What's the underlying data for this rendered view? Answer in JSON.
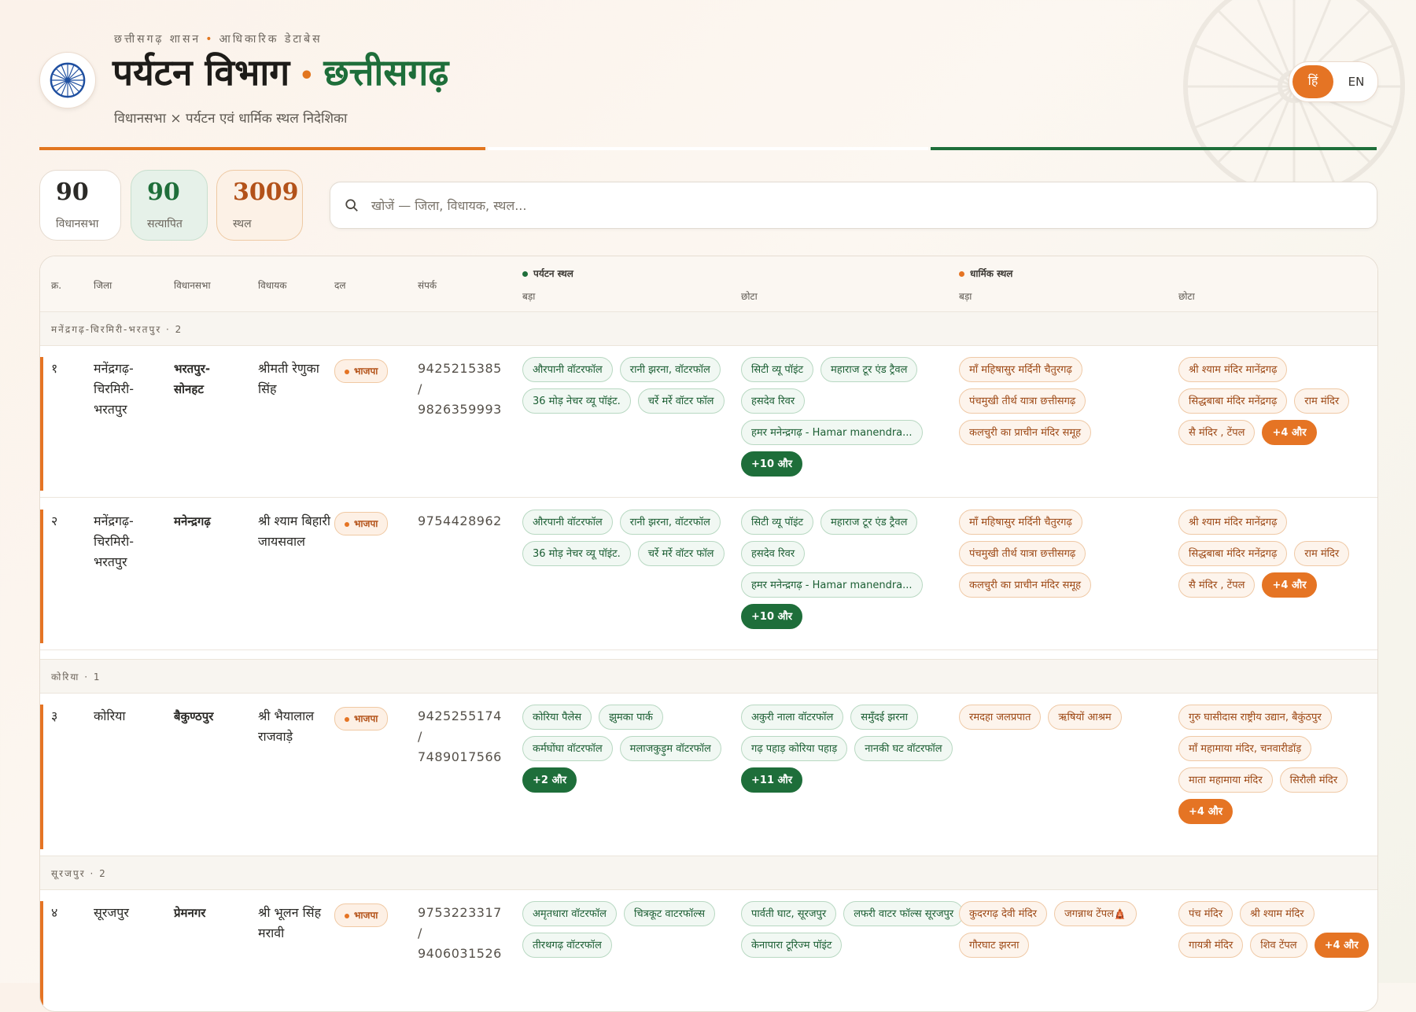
{
  "header": {
    "kicker_left": "छत्तीसगढ़ शासन",
    "kicker_right": "आधिकारिक डेटाबेस",
    "title_main": "पर्यटन विभाग",
    "title_state": "छत्तीसगढ़",
    "tagline": "विधानसभा × पर्यटन एवं धार्मिक स्थल निदेशिका",
    "lang_hi": "हिं",
    "lang_en": "EN"
  },
  "stats": [
    {
      "value": "90",
      "label": "विधानसभा"
    },
    {
      "value": "90",
      "label": "सत्यापित"
    },
    {
      "value": "3009",
      "label": "स्थल"
    }
  ],
  "search": {
    "placeholder": "खोजें — जिला, विधायक, स्थल..."
  },
  "table": {
    "col_sn": "क्र.",
    "col_district": "जिला",
    "col_assembly": "विधानसभा",
    "col_mla": "विधायक",
    "col_party": "दल",
    "col_contact": "संपर्क",
    "group_tourism": "पर्यटन स्थल",
    "group_religious": "धार्मिक स्थल",
    "sub_big": "बड़ा",
    "sub_small": "छोटा"
  },
  "colors": {
    "saffron": "#e57424",
    "green": "#1e6e3a"
  },
  "groups": [
    {
      "label": "मनेंद्रगढ़-चिरमिरी-भरतपुर · 2"
    },
    {
      "label": "कोरिया · 1"
    },
    {
      "label": "सूरजपुर · 2"
    }
  ],
  "rows": [
    {
      "sn": "१",
      "district": "मनेंद्रगढ़-चिरमिरी-भरतपुर",
      "assembly": "भरतपुर-सोनहट",
      "mla": "श्रीमती रेणुका सिंह",
      "party": "भाजपा",
      "phone": "9425215385 / 9826359993",
      "tour_big": [
        "औरपानी वॉटरफॉल",
        "रानी झरना, वॉटरफॉल",
        "36 मोड़ नेचर व्यू पॉइंट.",
        "चर्रे मर्रे वॉटर फॉल"
      ],
      "tour_small": [
        "सिटी व्यू पॉइंट",
        "महाराज टूर एंड ट्रैवल",
        "हसदेव रिवर",
        "हमर मनेन्द्रगढ़ - Hamar manendra..."
      ],
      "tour_small_more": "+10 और",
      "rel_big": [
        "माँ महिषासुर मर्दिनी चैतुरगढ़",
        "पंचमुखी तीर्थ यात्रा छत्तीसगढ़",
        "कलचुरी का प्राचीन मंदिर समूह"
      ],
      "rel_small": [
        "श्री श्याम मंदिर मानेंद्रगढ़",
        "सिद्धबाबा मंदिर मनेंद्रगढ़",
        "राम मंदिर",
        "सै मंदिर , टेंपल"
      ],
      "rel_small_more": "+4 और"
    },
    {
      "sn": "२",
      "district": "मनेंद्रगढ़-चिरमिरी-भरतपुर",
      "assembly": "मनेन्द्रगढ़",
      "mla": "श्री श्याम बिहारी जायसवाल",
      "party": "भाजपा",
      "phone": "9754428962",
      "tour_big": [
        "औरपानी वॉटरफॉल",
        "रानी झरना, वॉटरफॉल",
        "36 मोड़ नेचर व्यू पॉइंट.",
        "चर्रे मर्रे वॉटर फॉल"
      ],
      "tour_small": [
        "सिटी व्यू पॉइंट",
        "महाराज टूर एंड ट्रैवल",
        "हसदेव रिवर",
        "हमर मनेन्द्रगढ़ - Hamar manendra..."
      ],
      "tour_small_more": "+10 और",
      "rel_big": [
        "माँ महिषासुर मर्दिनी चैतुरगढ़",
        "पंचमुखी तीर्थ यात्रा छत्तीसगढ़",
        "कलचुरी का प्राचीन मंदिर समूह"
      ],
      "rel_small": [
        "श्री श्याम मंदिर मानेंद्रगढ़",
        "सिद्धबाबा मंदिर मनेंद्रगढ़",
        "राम मंदिर",
        "सै मंदिर , टेंपल"
      ],
      "rel_small_more": "+4 और"
    },
    {
      "sn": "३",
      "district": "कोरिया",
      "assembly": "बैकुण्ठपुर",
      "mla": "श्री भैयालाल राजवाड़े",
      "party": "भाजपा",
      "phone": "9425255174 / 7489017566",
      "tour_big": [
        "कोरिया पैलेस",
        "झुमका पार्क",
        "कर्मघोंघा वॉटरफॉल",
        "मलाजकुड़ुम वॉटरफॉल"
      ],
      "tour_big_more": "+2 और",
      "tour_small": [
        "अकुरी नाला वॉटरफॉल",
        "समुँदई झरना",
        "गढ़ पहाड़ कोरिया पहाड़",
        "नानकी घट वॉटरफॉल"
      ],
      "tour_small_more": "+11 और",
      "rel_big": [
        "रमदहा जलप्रपात",
        "ऋषियों आश्रम"
      ],
      "rel_small": [
        "गुरु घासीदास राष्ट्रीय उद्यान, बैकुंठपुर",
        "माँ महामाया मंदिर, चनवारीडॉड़",
        "माता महामाया मंदिर",
        "सिरौली मंदिर"
      ],
      "rel_small_more": "+4 और"
    },
    {
      "sn": "४",
      "district": "सूरजपुर",
      "assembly": "प्रेमनगर",
      "mla": "श्री भूलन सिंह मरावी",
      "party": "भाजपा",
      "phone": "9753223317 / 9406031526",
      "tour_big": [
        "अमृतधारा वॉटरफॉल",
        "चित्रकूट वाटरफॉल्स",
        "तीरथगढ़ वॉटरफॉल"
      ],
      "tour_small": [
        "पार्वती घाट, सूरजपुर",
        "लफरी वाटर फॉल्स सूरजपुर",
        "केनापारा टूरिज्म पॉइंट"
      ],
      "rel_big": [
        "कुदरगढ़ देवी मंदिर",
        "जगन्नाथ टेंपल🛕",
        "गौरघाट झरना"
      ],
      "rel_small": [
        "पंच मंदिर",
        "श्री श्याम मंदिर",
        "गायत्री मंदिर",
        "शिव टेंपल"
      ],
      "rel_small_more": "+4 और"
    }
  ]
}
